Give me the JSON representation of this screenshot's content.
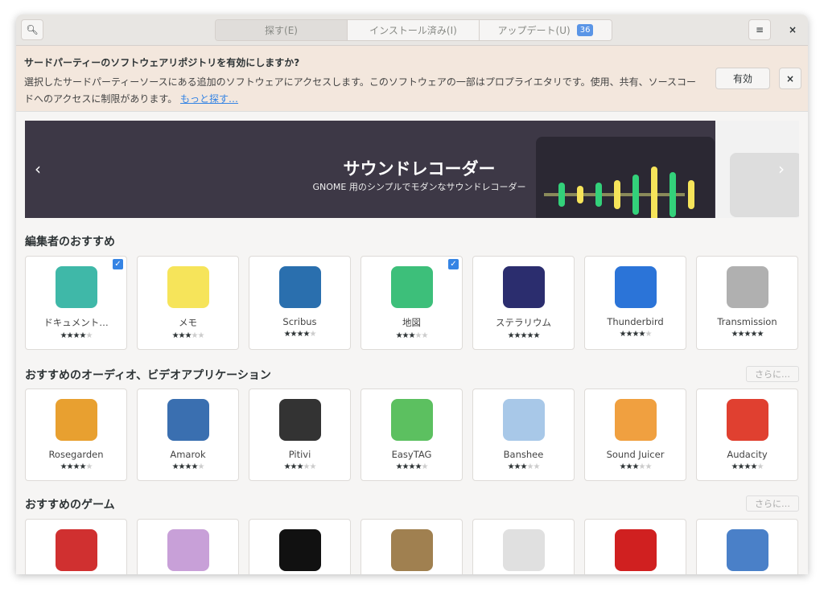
{
  "header": {
    "tabs": [
      {
        "label": "探す(E)"
      },
      {
        "label": "インストール済み(I)"
      },
      {
        "label": "アップデート(U)",
        "badge": "36"
      }
    ],
    "search_icon": "search-icon",
    "menu_icon": "hamburger-icon",
    "close_icon": "close-icon"
  },
  "infobar": {
    "title": "サードパーティーのソフトウェアリポジトリを有効にしますか?",
    "body": "選択したサードパーティーソースにある追加のソフトウェアにアクセスします。このソフトウェアの一部はプロプライエタリです。使用、共有、ソースコードへのアクセスに制限があります。",
    "link": "もっと探す…",
    "enable_label": "有効",
    "close_label": "×"
  },
  "banner": {
    "title": "サウンドレコーダー",
    "subtitle": "GNOME 用のシンプルでモダンなサウンドレコーダー",
    "prev": "‹",
    "next": "›"
  },
  "sections": [
    {
      "title": "編集者のおすすめ",
      "more": "",
      "apps": [
        {
          "name": "ドキュメント…",
          "rating": 4,
          "installed": true,
          "color": "#3fb8a8"
        },
        {
          "name": "メモ",
          "rating": 3,
          "installed": false,
          "color": "#f6e45a"
        },
        {
          "name": "Scribus",
          "rating": 4,
          "installed": false,
          "color": "#2a6fae"
        },
        {
          "name": "地図",
          "rating": 3,
          "installed": true,
          "color": "#3dbf7a"
        },
        {
          "name": "ステラリウム",
          "rating": 5,
          "installed": false,
          "color": "#2b2d6e"
        },
        {
          "name": "Thunderbird",
          "rating": 4,
          "installed": false,
          "color": "#2b74d8"
        },
        {
          "name": "Transmission",
          "rating": 5,
          "installed": false,
          "color": "#b0b0b0"
        }
      ]
    },
    {
      "title": "おすすめのオーディオ、ビデオアプリケーション",
      "more": "さらに…",
      "apps": [
        {
          "name": "Rosegarden",
          "rating": 4,
          "color": "#e8a030"
        },
        {
          "name": "Amarok",
          "rating": 4,
          "color": "#3a6fb0"
        },
        {
          "name": "Pitivi",
          "rating": 3,
          "color": "#333333"
        },
        {
          "name": "EasyTAG",
          "rating": 4,
          "color": "#5cc060"
        },
        {
          "name": "Banshee",
          "rating": 3,
          "color": "#a8c8e8"
        },
        {
          "name": "Sound Juicer",
          "rating": 3,
          "color": "#f0a040"
        },
        {
          "name": "Audacity",
          "rating": 4,
          "color": "#e04030"
        }
      ]
    },
    {
      "title": "おすすめのゲーム",
      "more": "さらに…",
      "apps": [
        {
          "name": "",
          "color": "#d03030"
        },
        {
          "name": "",
          "color": "#c8a0d8"
        },
        {
          "name": "",
          "color": "#111111"
        },
        {
          "name": "",
          "color": "#a08050"
        },
        {
          "name": "",
          "color": "#e0e0e0"
        },
        {
          "name": "",
          "color": "#d02020"
        },
        {
          "name": "",
          "color": "#4a80c8"
        }
      ]
    }
  ]
}
